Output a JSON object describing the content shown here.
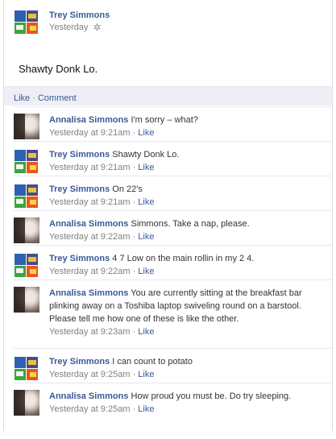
{
  "post": {
    "author": "Trey Simmons",
    "time": "Yesterday",
    "text": "Shawty Donk Lo."
  },
  "actions": {
    "like": "Like",
    "separator": "·",
    "comment": "Comment"
  },
  "comments": [
    {
      "author": "Annalisa Simmons",
      "text": "I'm sorry – what?",
      "time": "Yesterday at 9:21am",
      "like": "Like",
      "avatar": "annalisa"
    },
    {
      "author": "Trey Simmons",
      "text": "Shawty Donk Lo.",
      "time": "Yesterday at 9:21am",
      "like": "Like",
      "avatar": "trey"
    },
    {
      "author": "Trey Simmons",
      "text": "On 22's",
      "time": "Yesterday at 9:21am",
      "like": "Like",
      "avatar": "trey"
    },
    {
      "author": "Annalisa Simmons",
      "text": "Simmons. Take a nap, please.",
      "time": "Yesterday at 9:22am",
      "like": "Like",
      "avatar": "annalisa"
    },
    {
      "author": "Trey Simmons",
      "text": "4 7 Low on the main rollin in my 2 4.",
      "time": "Yesterday at 9:22am",
      "like": "Like",
      "avatar": "trey"
    },
    {
      "author": "Annalisa Simmons",
      "text": "You are currently sitting at the breakfast bar plinking away on a Toshiba laptop swiveling round on a barstool. Please tell me how one of these is like the other.",
      "time": "Yesterday at 9:23am",
      "like": "Like",
      "avatar": "annalisa"
    },
    {
      "author": "Trey Simmons",
      "text": "I can count to potato",
      "time": "Yesterday at 9:25am",
      "like": "Like",
      "avatar": "trey"
    },
    {
      "author": "Annalisa Simmons",
      "text": "How proud you must be. Do try sleeping.",
      "time": "Yesterday at 9:25am",
      "like": "Like",
      "avatar": "annalisa"
    }
  ],
  "colors": {
    "link": "#3b5998",
    "meta": "#808080",
    "band": "#edeff4"
  }
}
